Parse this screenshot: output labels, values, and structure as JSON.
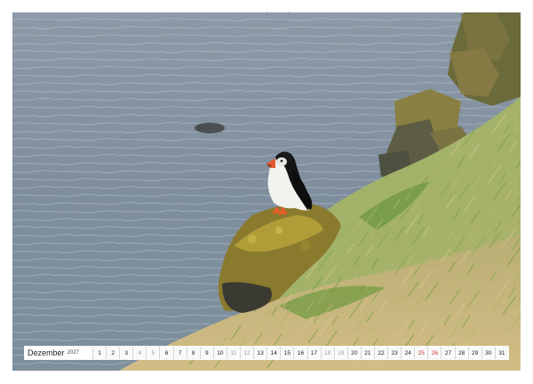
{
  "calendar": {
    "month": "Dezember",
    "year": "2027",
    "days": [
      {
        "n": "1",
        "type": "normal"
      },
      {
        "n": "2",
        "type": "normal"
      },
      {
        "n": "3",
        "type": "normal"
      },
      {
        "n": "4",
        "type": "weekend"
      },
      {
        "n": "5",
        "type": "weekend"
      },
      {
        "n": "6",
        "type": "normal"
      },
      {
        "n": "7",
        "type": "normal"
      },
      {
        "n": "8",
        "type": "normal"
      },
      {
        "n": "9",
        "type": "normal"
      },
      {
        "n": "10",
        "type": "normal"
      },
      {
        "n": "11",
        "type": "weekend"
      },
      {
        "n": "12",
        "type": "weekend"
      },
      {
        "n": "13",
        "type": "normal"
      },
      {
        "n": "14",
        "type": "normal"
      },
      {
        "n": "15",
        "type": "normal"
      },
      {
        "n": "16",
        "type": "normal"
      },
      {
        "n": "17",
        "type": "normal"
      },
      {
        "n": "18",
        "type": "weekend"
      },
      {
        "n": "19",
        "type": "weekend"
      },
      {
        "n": "20",
        "type": "normal"
      },
      {
        "n": "21",
        "type": "normal"
      },
      {
        "n": "22",
        "type": "normal"
      },
      {
        "n": "23",
        "type": "normal"
      },
      {
        "n": "24",
        "type": "normal"
      },
      {
        "n": "25",
        "type": "holiday"
      },
      {
        "n": "26",
        "type": "holiday"
      },
      {
        "n": "27",
        "type": "normal"
      },
      {
        "n": "28",
        "type": "normal"
      },
      {
        "n": "29",
        "type": "normal"
      },
      {
        "n": "30",
        "type": "normal"
      },
      {
        "n": "31",
        "type": "normal"
      }
    ]
  },
  "colors": {
    "water": "#7f8f9f",
    "grass": "#8fae5a",
    "rock": "#6e6a3c",
    "holiday": "#c0392b"
  }
}
